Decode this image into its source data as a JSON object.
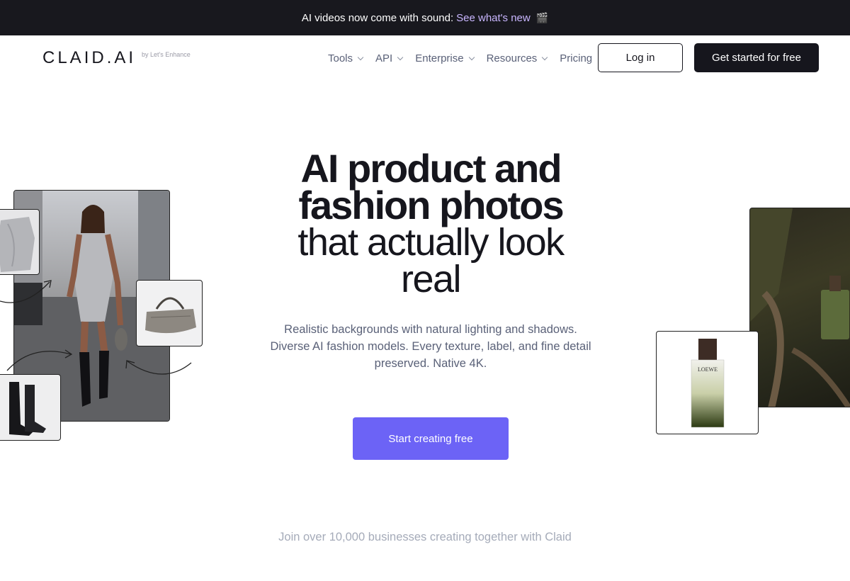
{
  "announcement": {
    "text": "AI videos now come with sound:",
    "link": "See what's new",
    "emoji": "🎬"
  },
  "nav": {
    "logo": "CLAID.AI",
    "logo_sub": "by Let's Enhance",
    "menu": [
      {
        "label": "Tools",
        "dropdown": true
      },
      {
        "label": "API",
        "dropdown": true
      },
      {
        "label": "Enterprise",
        "dropdown": true
      },
      {
        "label": "Resources",
        "dropdown": true
      },
      {
        "label": "Pricing",
        "dropdown": false
      }
    ],
    "login": "Log in",
    "get_started": "Get started for free"
  },
  "hero": {
    "line1": "AI product and",
    "line2": "fashion photos",
    "line3": "that actually look",
    "line4": "real",
    "subtitle": "Realistic backgrounds with natural lighting and shadows. Diverse AI fashion models. Every texture, label, and fine detail preserved. Native 4K.",
    "cta": "Start creating free"
  },
  "social_proof": "Join over 10,000 businesses creating together with Claid",
  "perfume_label": "LOEWE",
  "colors": {
    "announce_bg": "#18181e",
    "link": "#c9b6ff",
    "primary": "#16161d",
    "cta": "#6c63f6",
    "muted": "#5a6178"
  }
}
